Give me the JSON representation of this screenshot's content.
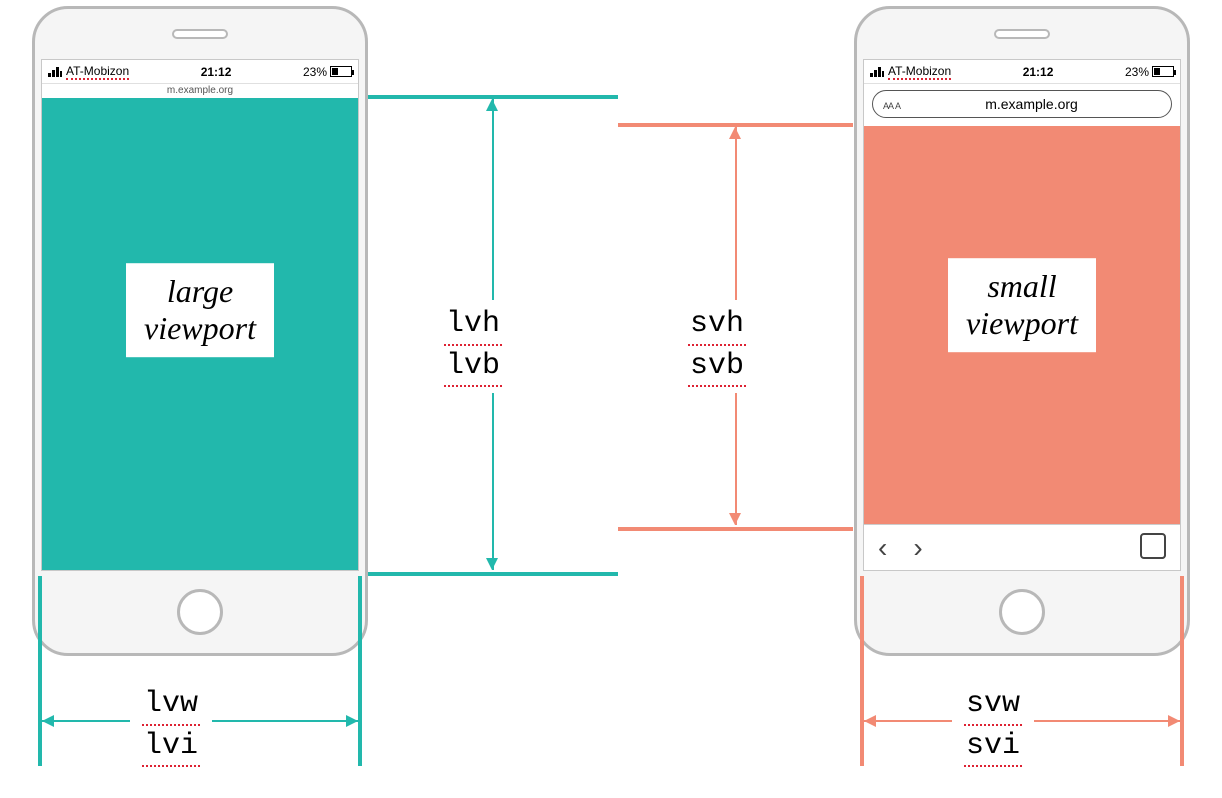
{
  "status": {
    "carrier": "AT-Mobizon",
    "time": "21:12",
    "battery_pct": "23%"
  },
  "urls": {
    "mini": "m.example.org",
    "full": "m.example.org"
  },
  "left_phone": {
    "viewport_label_line1": "large",
    "viewport_label_line2": "viewport"
  },
  "right_phone": {
    "viewport_label_line1": "small",
    "viewport_label_line2": "viewport",
    "address_aa_small": "AA",
    "address_aa_big": "A"
  },
  "units": {
    "large_height_1": "lvh",
    "large_height_2": "lvb",
    "small_height_1": "svh",
    "small_height_2": "svb",
    "large_width_1": "lvw",
    "large_width_2": "lvi",
    "small_width_1": "svw",
    "small_width_2": "svi"
  },
  "colors": {
    "teal": "#22b8ac",
    "salmon": "#f28a74"
  }
}
